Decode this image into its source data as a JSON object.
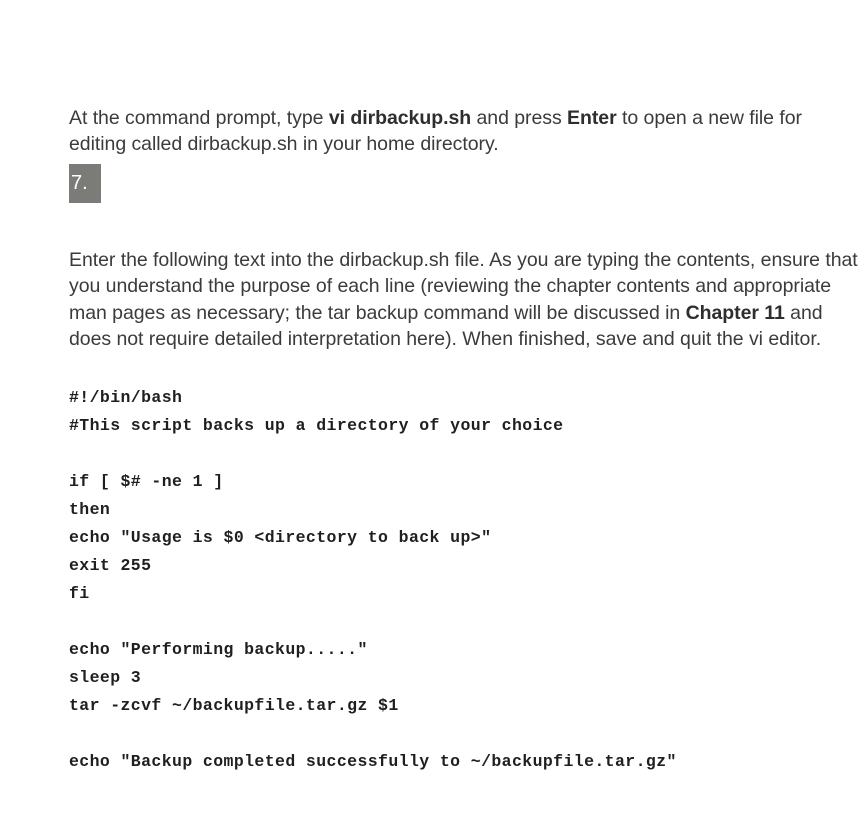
{
  "document": {
    "paragraphs": {
      "intro": {
        "segments": [
          {
            "text": "At the command prompt, type ",
            "bold": false
          },
          {
            "text": "vi dirbackup.sh",
            "bold": true
          },
          {
            "text": " and press ",
            "bold": false
          },
          {
            "text": "Enter",
            "bold": true
          },
          {
            "text": " to open a new file for editing called dirbackup.sh in your home directory.",
            "bold": false
          }
        ]
      },
      "instruction": {
        "segments": [
          {
            "text": "Enter the following text into the dirbackup.sh file. As you are typing the contents, ensure that you understand the purpose of each line (reviewing the chapter contents and appropriate man pages as necessary; the tar backup command will be discussed in ",
            "bold": false
          },
          {
            "text": "Chapter 11",
            "bold": true
          },
          {
            "text": " and does not require detailed interpretation here). When finished, save and quit the vi editor.",
            "bold": false
          }
        ]
      }
    },
    "list_marker": {
      "label": "7.",
      "highlight_color": "#7b7b78",
      "text_color": "#ffffff"
    },
    "code_block": {
      "language": "bash",
      "lines": [
        "#!/bin/bash",
        "#This script backs up a directory of your choice",
        "",
        "if [ $# -ne 1 ]",
        "then",
        "echo \"Usage is $0 <directory to back up>\"",
        "exit 255",
        "fi",
        "",
        "echo \"Performing backup.....\"",
        "sleep 3",
        "tar -zcvf ~/backupfile.tar.gz $1",
        "",
        "echo \"Backup completed successfully to ~/backupfile.tar.gz\""
      ]
    },
    "colors": {
      "background": "#ffffff",
      "body_text": "#3b3b3b",
      "code_text": "#1f1f1f",
      "marker_highlight": "#7b7b78"
    }
  }
}
